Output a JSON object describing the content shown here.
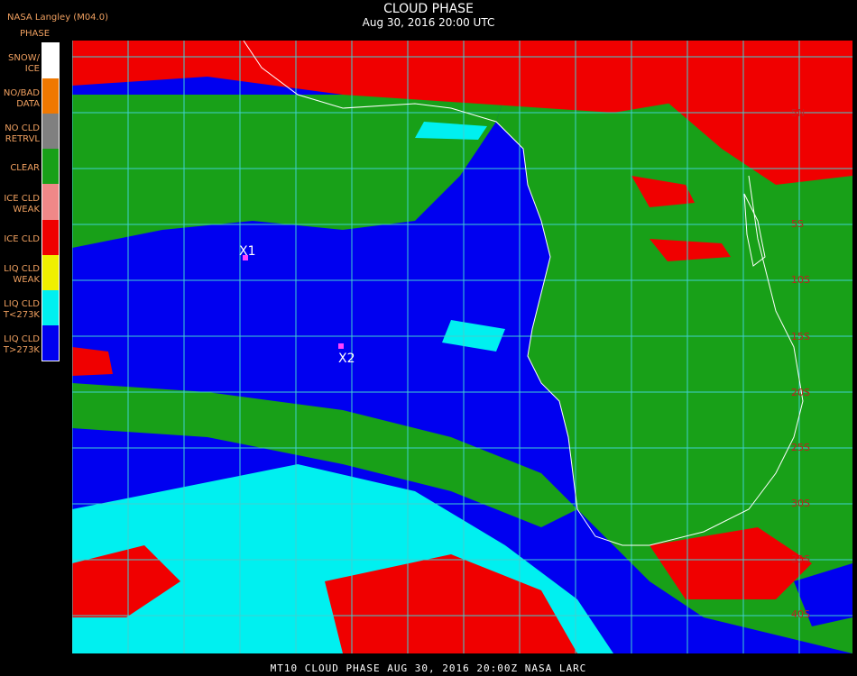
{
  "header": {
    "source": "NASA Langley (M04.0)",
    "phase_label": "PHASE",
    "title": "CLOUD PHASE",
    "subtitle": "Aug 30, 2016 20:00 UTC"
  },
  "legend": [
    {
      "label": "SNOW/\nICE",
      "color": "#ffffff"
    },
    {
      "label": "NO/BAD\nDATA",
      "color": "#f07800"
    },
    {
      "label": "NO CLD\nRETRVL",
      "color": "#808080"
    },
    {
      "label": "CLEAR",
      "color": "#18a018"
    },
    {
      "label": "ICE CLD\nWEAK",
      "color": "#f08888"
    },
    {
      "label": "ICE CLD",
      "color": "#f00000"
    },
    {
      "label": "LIQ CLD\nWEAK",
      "color": "#f0f000"
    },
    {
      "label": "LIQ CLD\nT<273K",
      "color": "#00f0f0"
    },
    {
      "label": "LIQ CLD\nT>273K",
      "color": "#0000f0"
    }
  ],
  "map": {
    "lat_labels": [
      "5N",
      "5S",
      "10S",
      "15S",
      "20S",
      "25S",
      "30S",
      "35S",
      "40S"
    ],
    "markers": [
      {
        "label": "X1"
      },
      {
        "label": "X2"
      }
    ],
    "grid_color": "#40d0d0",
    "marker_color": "#ff40ff"
  },
  "footer": {
    "text": "MT10  CLOUD PHASE   AUG 30, 2016 20:00Z   NASA LARC"
  }
}
